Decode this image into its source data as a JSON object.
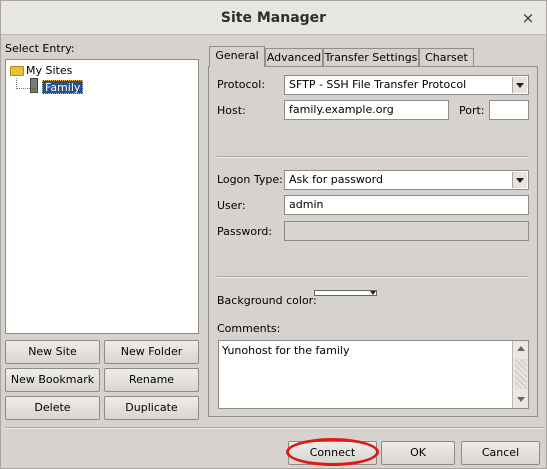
{
  "window": {
    "title": "Site Manager",
    "close_glyph": "×"
  },
  "entry_label": "Select Entry:",
  "tree": {
    "root_label": "My Sites",
    "root_icon": "folder-icon",
    "child_label": "Family",
    "child_icon": "server-icon"
  },
  "site_buttons": {
    "new_site": "New Site",
    "new_folder": "New Folder",
    "new_bookmark": "New Bookmark",
    "rename": "Rename",
    "delete": "Delete",
    "duplicate": "Duplicate"
  },
  "tabs": [
    "General",
    "Advanced",
    "Transfer Settings",
    "Charset"
  ],
  "active_tab": "General",
  "general": {
    "protocol_label": "Protocol:",
    "protocol_value": "SFTP - SSH File Transfer Protocol",
    "host_label": "Host:",
    "host_value": "family.example.org",
    "port_label": "Port:",
    "port_value": "",
    "logon_type_label": "Logon Type:",
    "logon_type_value": "Ask for password",
    "user_label": "User:",
    "user_value": "admin",
    "password_label": "Password:",
    "password_value": "",
    "background_color_label": "Background color:",
    "comments_label": "Comments:",
    "comments_value": "Yunohost for the family"
  },
  "dialog_buttons": {
    "connect": "Connect",
    "ok": "OK",
    "cancel": "Cancel"
  },
  "colors": {
    "selection": "#2b4f80",
    "highlight_ring": "#e01818",
    "folder": "#e9c23a"
  }
}
